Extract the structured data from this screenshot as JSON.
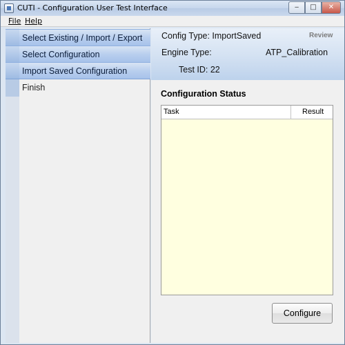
{
  "window": {
    "title": "CUTI - Configuration User Test Interface",
    "controls": {
      "minimize": "‒",
      "maximize": "□",
      "close": "✕"
    }
  },
  "menu": {
    "file": "File",
    "help": "Help"
  },
  "nav": {
    "items": [
      {
        "label": "Select Existing / Import / Export",
        "state": "active"
      },
      {
        "label": "Select Configuration",
        "state": "active"
      },
      {
        "label": "Import Saved Configuration",
        "state": "active"
      },
      {
        "label": "Finish",
        "state": "inactive"
      }
    ]
  },
  "header": {
    "config_type": "Config Type: ImportSaved",
    "review": "Review",
    "engine_type_label": "Engine Type:",
    "engine_type_value": "ATP_Calibration",
    "test_id": "Test ID: 22"
  },
  "status": {
    "title": "Configuration Status",
    "columns": [
      "Task",
      "Result"
    ],
    "rows": []
  },
  "actions": {
    "configure": "Configure"
  },
  "colors": {
    "accent_blue": "#a7c2ea",
    "header_gradient_bottom": "#bdd2ec",
    "table_background": "#ffffe0",
    "review_gray": "#7b7b7b"
  }
}
